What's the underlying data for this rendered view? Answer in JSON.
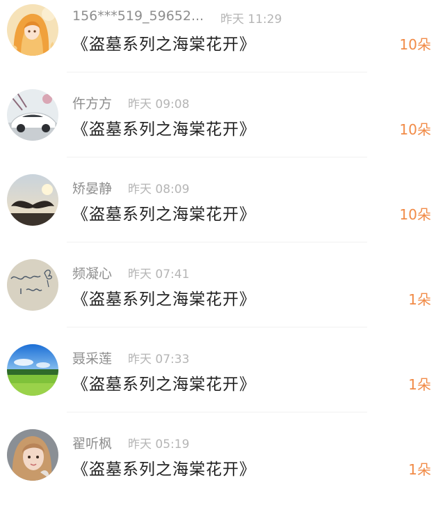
{
  "gift_list": {
    "records": [
      {
        "user_name": "156***519_59652...",
        "time": "昨天 11:29",
        "book_title": "《盗墓系列之海棠花开》",
        "gift_count": "10朵",
        "avatar_icon": "anime-girl-avatar-icon"
      },
      {
        "user_name": "仵方方",
        "time": "昨天 09:08",
        "book_title": "《盗墓系列之海棠花开》",
        "gift_count": "10朵",
        "avatar_icon": "white-car-avatar-icon"
      },
      {
        "user_name": "矫晏静",
        "time": "昨天 08:09",
        "book_title": "《盗墓系列之海棠花开》",
        "gift_count": "10朵",
        "avatar_icon": "mustache-sunset-avatar-icon"
      },
      {
        "user_name": "频凝心",
        "time": "昨天 07:41",
        "book_title": "《盗墓系列之海棠花开》",
        "gift_count": "1朵",
        "avatar_icon": "handwriting-note-avatar-icon"
      },
      {
        "user_name": "聂采莲",
        "time": "昨天 07:33",
        "book_title": "《盗墓系列之海棠花开》",
        "gift_count": "1朵",
        "avatar_icon": "sky-meadow-avatar-icon"
      },
      {
        "user_name": "翟听枫",
        "time": "昨天 05:19",
        "book_title": "《盗墓系列之海棠花开》",
        "gift_count": "1朵",
        "avatar_icon": "girl-photo-avatar-icon"
      }
    ]
  },
  "colors": {
    "count_accent": "#f18b47",
    "name_gray": "#8e8e8e",
    "time_gray": "#b5b5b5",
    "title_dark": "#222222"
  }
}
